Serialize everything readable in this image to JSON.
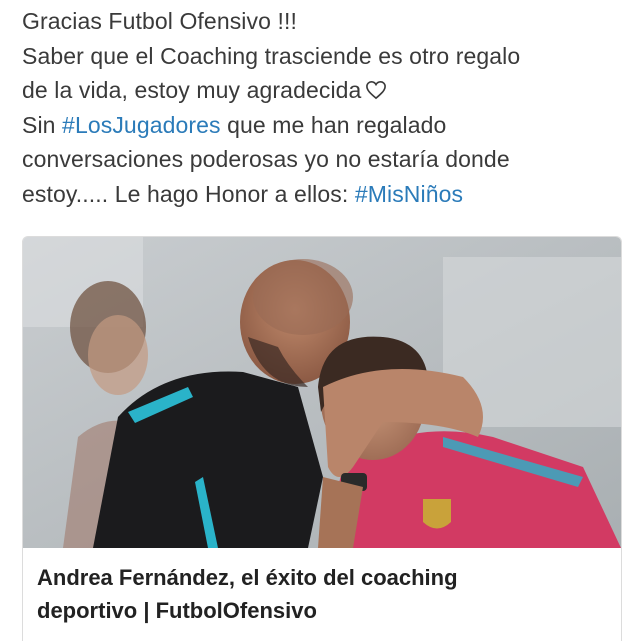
{
  "tweet": {
    "lines": [
      {
        "text": "Gracias Futbol Ofensivo !!!"
      },
      {
        "text": "Saber que el Coaching trasciende es otro regalo"
      },
      {
        "text": "de la vida, estoy muy agradecida",
        "icon": "heart-icon"
      },
      {
        "before": "Sin ",
        "hashtag": "#LosJugadores",
        "after": " que me han regalado"
      },
      {
        "text": "conversaciones poderosas yo no estaría donde"
      },
      {
        "before": "estoy..... Le hago Honor a ellos: ",
        "hashtag": "#MisNiños"
      }
    ],
    "hashtag_color": "#2b7bb9",
    "text_color": "#3a3a3a"
  },
  "card": {
    "image_icon": "photo-coach-embracing-player",
    "title_line1": "Andrea Fernández, el éxito del coaching",
    "title_line2": "deportivo | FutbolOfensivo"
  }
}
